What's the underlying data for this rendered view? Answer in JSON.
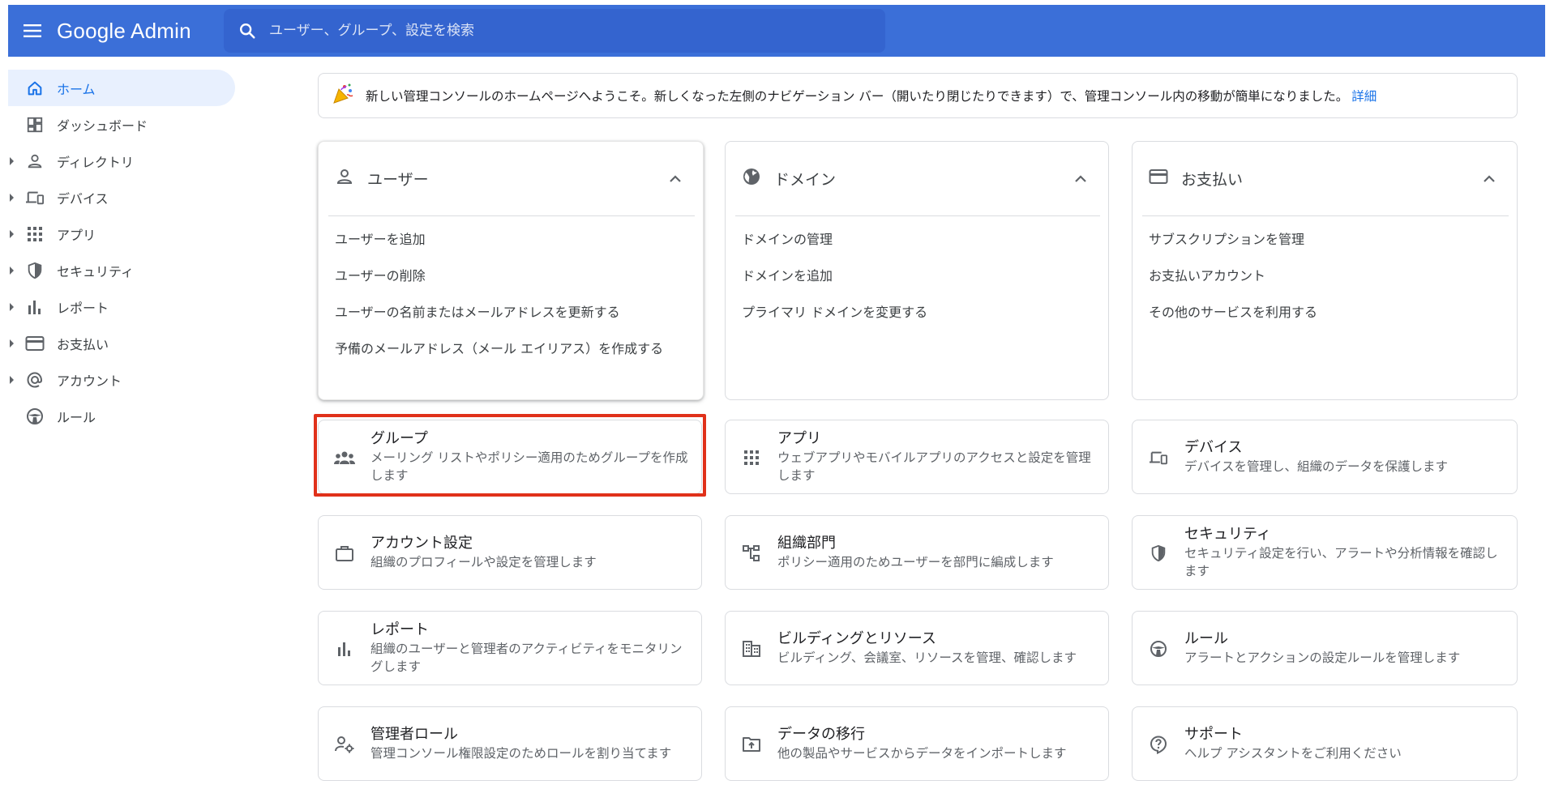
{
  "header": {
    "brand": "Google Admin",
    "search_placeholder": "ユーザー、グループ、設定を検索"
  },
  "sidebar": {
    "items": [
      {
        "label": "ホーム",
        "icon": "home-icon",
        "active": true,
        "expandable": false
      },
      {
        "label": "ダッシュボード",
        "icon": "dashboard-icon",
        "active": false,
        "expandable": false
      },
      {
        "label": "ディレクトリ",
        "icon": "person-icon",
        "active": false,
        "expandable": true
      },
      {
        "label": "デバイス",
        "icon": "devices-icon",
        "active": false,
        "expandable": true
      },
      {
        "label": "アプリ",
        "icon": "apps-grid-icon",
        "active": false,
        "expandable": true
      },
      {
        "label": "セキュリティ",
        "icon": "shield-icon",
        "active": false,
        "expandable": true
      },
      {
        "label": "レポート",
        "icon": "bar-chart-icon",
        "active": false,
        "expandable": true
      },
      {
        "label": "お支払い",
        "icon": "credit-card-icon",
        "active": false,
        "expandable": true
      },
      {
        "label": "アカウント",
        "icon": "at-sign-icon",
        "active": false,
        "expandable": true
      },
      {
        "label": "ルール",
        "icon": "rules-icon",
        "active": false,
        "expandable": false
      }
    ]
  },
  "banner": {
    "text": "新しい管理コンソールのホームページへようこそ。新しくなった左側のナビゲーション バー（開いたり閉じたりできます）で、管理コンソール内の移動が簡単になりました。",
    "link": "詳細",
    "icon": "party-popper-icon"
  },
  "cards": [
    {
      "title": "ユーザー",
      "icon": "person-icon",
      "links": [
        "ユーザーを追加",
        "ユーザーの削除",
        "ユーザーの名前またはメールアドレスを更新する",
        "予備のメールアドレス（メール エイリアス）を作成する"
      ]
    },
    {
      "title": "ドメイン",
      "icon": "globe-icon",
      "links": [
        "ドメインの管理",
        "ドメインを追加",
        "プライマリ ドメインを変更する"
      ]
    },
    {
      "title": "お支払い",
      "icon": "credit-card-icon",
      "links": [
        "サブスクリプションを管理",
        "お支払いアカウント",
        "その他のサービスを利用する"
      ]
    }
  ],
  "tiles": [
    {
      "title": "グループ",
      "desc": "メーリング リストやポリシー適用のためグループを作成します",
      "icon": "groups-icon"
    },
    {
      "title": "アプリ",
      "desc": "ウェブアプリやモバイルアプリのアクセスと設定を管理します",
      "icon": "apps-grid-icon"
    },
    {
      "title": "デバイス",
      "desc": "デバイスを管理し、組織のデータを保護します",
      "icon": "devices-icon"
    },
    {
      "title": "アカウント設定",
      "desc": "組織のプロフィールや設定を管理します",
      "icon": "briefcase-icon"
    },
    {
      "title": "組織部門",
      "desc": "ポリシー適用のためユーザーを部門に編成します",
      "icon": "org-chart-icon"
    },
    {
      "title": "セキュリティ",
      "desc": "セキュリティ設定を行い、アラートや分析情報を確認します",
      "icon": "shield-icon"
    },
    {
      "title": "レポート",
      "desc": "組織のユーザーと管理者のアクティビティをモニタリングします",
      "icon": "bar-chart-icon"
    },
    {
      "title": "ビルディングとリソース",
      "desc": "ビルディング、会議室、リソースを管理、確認します",
      "icon": "building-icon"
    },
    {
      "title": "ルール",
      "desc": "アラートとアクションの設定ルールを管理します",
      "icon": "rules-icon"
    },
    {
      "title": "管理者ロール",
      "desc": "管理コンソール権限設定のためロールを割り当てます",
      "icon": "admin-role-icon"
    },
    {
      "title": "データの移行",
      "desc": "他の製品やサービスからデータをインポートします",
      "icon": "data-migration-icon"
    },
    {
      "title": "サポート",
      "desc": "ヘルプ アシスタントをご利用ください",
      "icon": "help-icon"
    }
  ],
  "colors": {
    "header_bg": "#3b6fd8",
    "search_bg": "#3464cf",
    "active_nav_bg": "#e8f0fe",
    "accent": "#1a73e8",
    "highlight": "#e0311a"
  }
}
